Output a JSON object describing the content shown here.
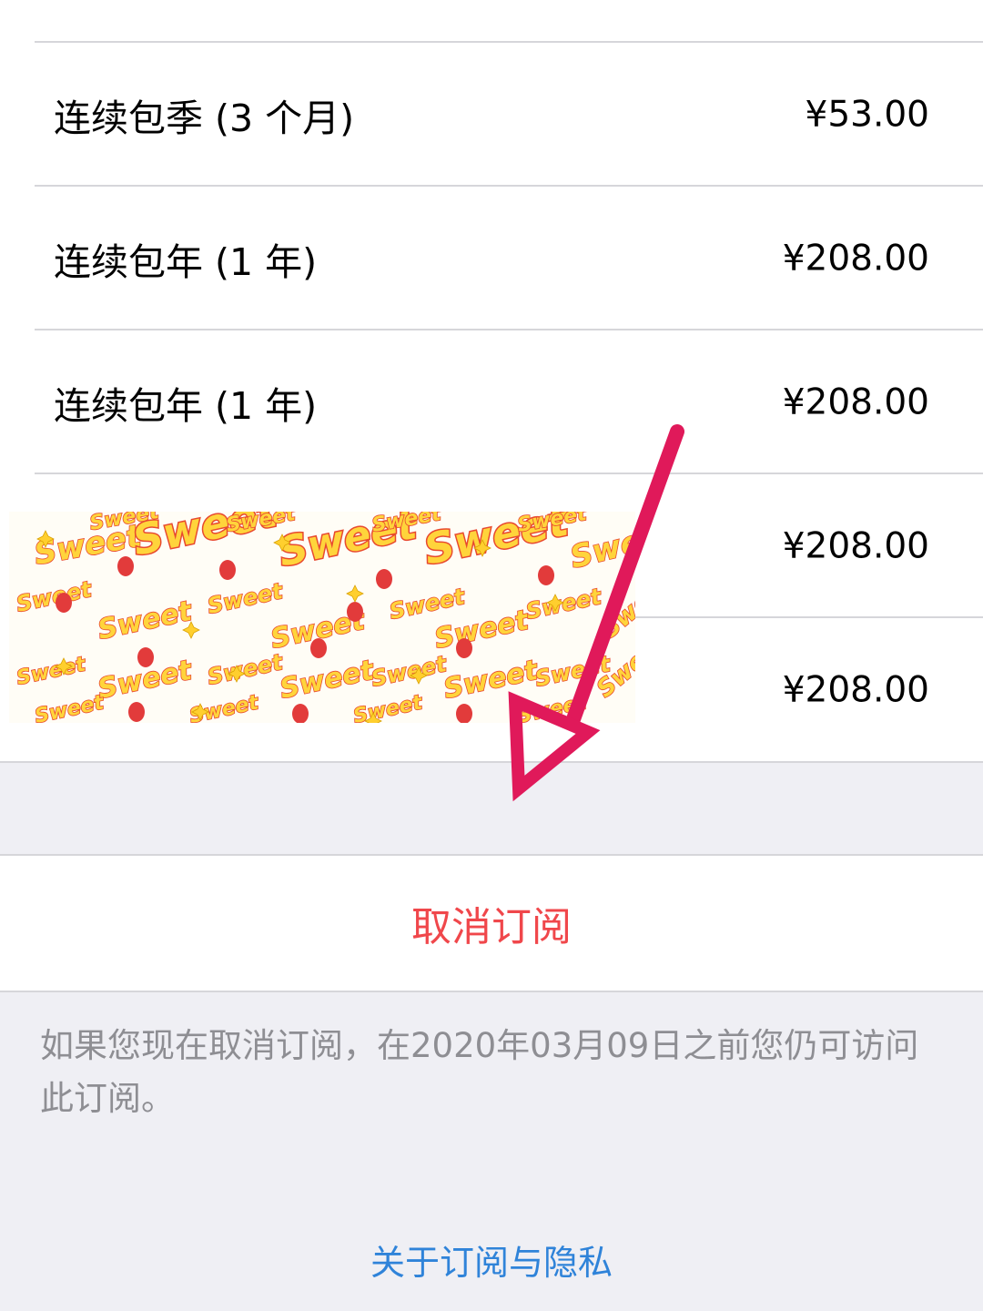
{
  "plans": [
    {
      "label": "连续包季 (3 个月)",
      "price": "¥53.00"
    },
    {
      "label": "连续包年 (1 年)",
      "price": "¥208.00"
    },
    {
      "label": "连续包年 (1 年)",
      "price": "¥208.00"
    },
    {
      "label": "",
      "price": "¥208.00"
    },
    {
      "label": "",
      "price": "¥208.00"
    }
  ],
  "cancel": {
    "label": "取消订阅",
    "color": "#f0474b"
  },
  "footer": {
    "note": "如果您现在取消订阅，在2020年03月09日之前您仍可访问此订阅。",
    "privacy_link": "关于订阅与隐私",
    "link_color": "#2f83d9"
  },
  "sticker": {
    "word": "Sweet"
  },
  "annotation": {
    "arrow_color": "#e0195a"
  }
}
